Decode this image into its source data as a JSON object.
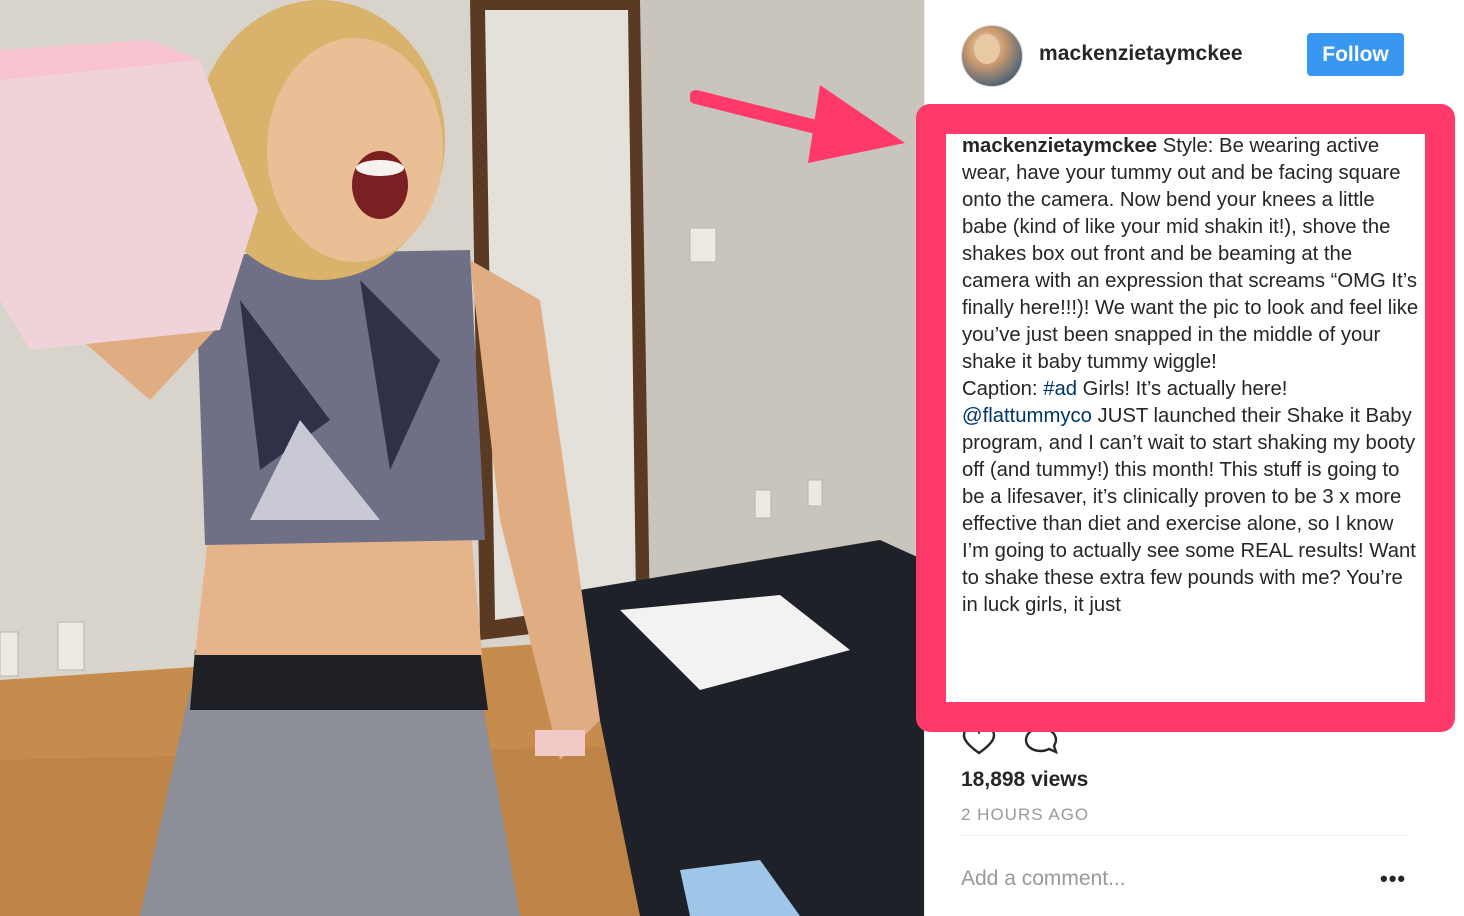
{
  "post": {
    "username": "mackenzietaymckee",
    "follow_label": "Follow",
    "caption": {
      "username": "mackenzietaymckee",
      "style_text": " Style: Be wearing active wear, have your tummy out and be facing square onto the camera. Now bend your knees a little babe (kind of like your mid shakin it!), shove the shakes box out front and be beaming at the camera with an expression that screams “OMG It’s finally here!!!)! We want the pic to look and feel like you’ve just been snapped in the middle of your shake it baby tummy wiggle!",
      "caption_label": "Caption: ",
      "hashtag": "#ad",
      "after_hashtag": " Girls! It’s actually here!",
      "mention": "@flattummyco",
      "body_text": " JUST launched their Shake it Baby program, and I can’t wait to start shaking my booty off (and tummy!) this month! This stuff is going to be a lifesaver, it’s clinically proven to be 3 x more effective than diet and exercise alone, so I know I’m going to actually see some REAL results! Want to shake these extra few pounds with me? You’re in luck girls, it just"
    },
    "views": "18,898 views",
    "timestamp": "2 HOURS AGO",
    "comment_placeholder": "Add a comment...",
    "more_options": "•••"
  },
  "icons": {
    "like": "heart-icon",
    "comment": "comment-icon",
    "avatar": "profile-avatar",
    "annotation": "arrow-annotation"
  },
  "colors": {
    "follow_button": "#3897f0",
    "link": "#003569",
    "highlight": "#ff3a6b",
    "muted_text": "#999999"
  }
}
